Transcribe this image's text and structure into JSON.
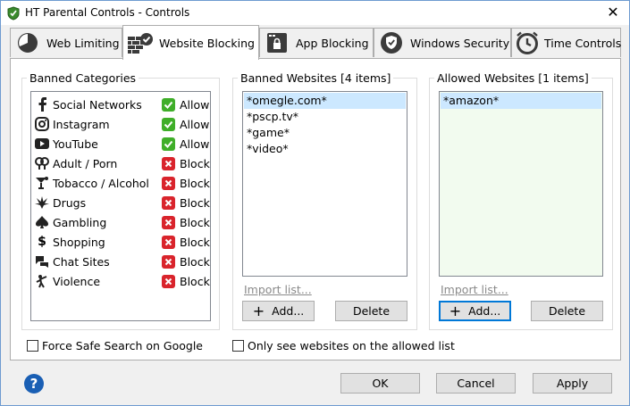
{
  "window": {
    "title": "HT Parental Controls - Controls",
    "close_glyph": "✕"
  },
  "tabs": [
    {
      "label": "Web Limiting",
      "icon": "clock-pie-icon"
    },
    {
      "label": "Website Blocking",
      "icon": "brick-wall-check-icon"
    },
    {
      "label": "App Blocking",
      "icon": "app-window-lock-icon"
    },
    {
      "label": "Windows Security",
      "icon": "shield-check-icon"
    },
    {
      "label": "Time Controls",
      "icon": "clock-icon"
    }
  ],
  "active_tab": "Website Blocking",
  "categories": {
    "title": "Banned Categories",
    "items": [
      {
        "label": "Social Networks",
        "icon": "facebook-icon",
        "status": "Allow"
      },
      {
        "label": "Instagram",
        "icon": "instagram-icon",
        "status": "Allow"
      },
      {
        "label": "YouTube",
        "icon": "youtube-icon",
        "status": "Allow"
      },
      {
        "label": "Adult / Porn",
        "icon": "adult-icon",
        "status": "Block"
      },
      {
        "label": "Tobacco / Alcohol",
        "icon": "cocktail-icon",
        "status": "Block"
      },
      {
        "label": "Drugs",
        "icon": "leaf-icon",
        "status": "Block"
      },
      {
        "label": "Gambling",
        "icon": "spade-icon",
        "status": "Block"
      },
      {
        "label": "Shopping",
        "icon": "dollar-icon",
        "status": "Block"
      },
      {
        "label": "Chat Sites",
        "icon": "chat-bubbles-icon",
        "status": "Block"
      },
      {
        "label": "Violence",
        "icon": "fighter-icon",
        "status": "Block"
      }
    ]
  },
  "banned": {
    "title": "Banned Websites [4 items]",
    "items": [
      "*omegle.com*",
      "*pscp.tv*",
      "*game*",
      "*video*"
    ],
    "selected": "*omegle.com*",
    "import_label": "Import list...",
    "add_label": "Add...",
    "delete_label": "Delete"
  },
  "allowed": {
    "title": "Allowed Websites [1 items]",
    "items": [
      "*amazon*"
    ],
    "selected": "*amazon*",
    "import_label": "Import list...",
    "add_label": "Add...",
    "delete_label": "Delete"
  },
  "options": {
    "safe_search": {
      "label": "Force Safe Search on Google",
      "checked": false
    },
    "only_allowed": {
      "label": "Only see websites on the allowed list",
      "checked": false
    }
  },
  "footer": {
    "ok": "OK",
    "cancel": "Cancel",
    "apply": "Apply",
    "help_glyph": "?"
  },
  "colors": {
    "allow": "#3fae29",
    "block": "#d9242c",
    "selection": "#cce8ff",
    "allowed_bg": "#f2fbef",
    "focus": "#0078d7"
  }
}
